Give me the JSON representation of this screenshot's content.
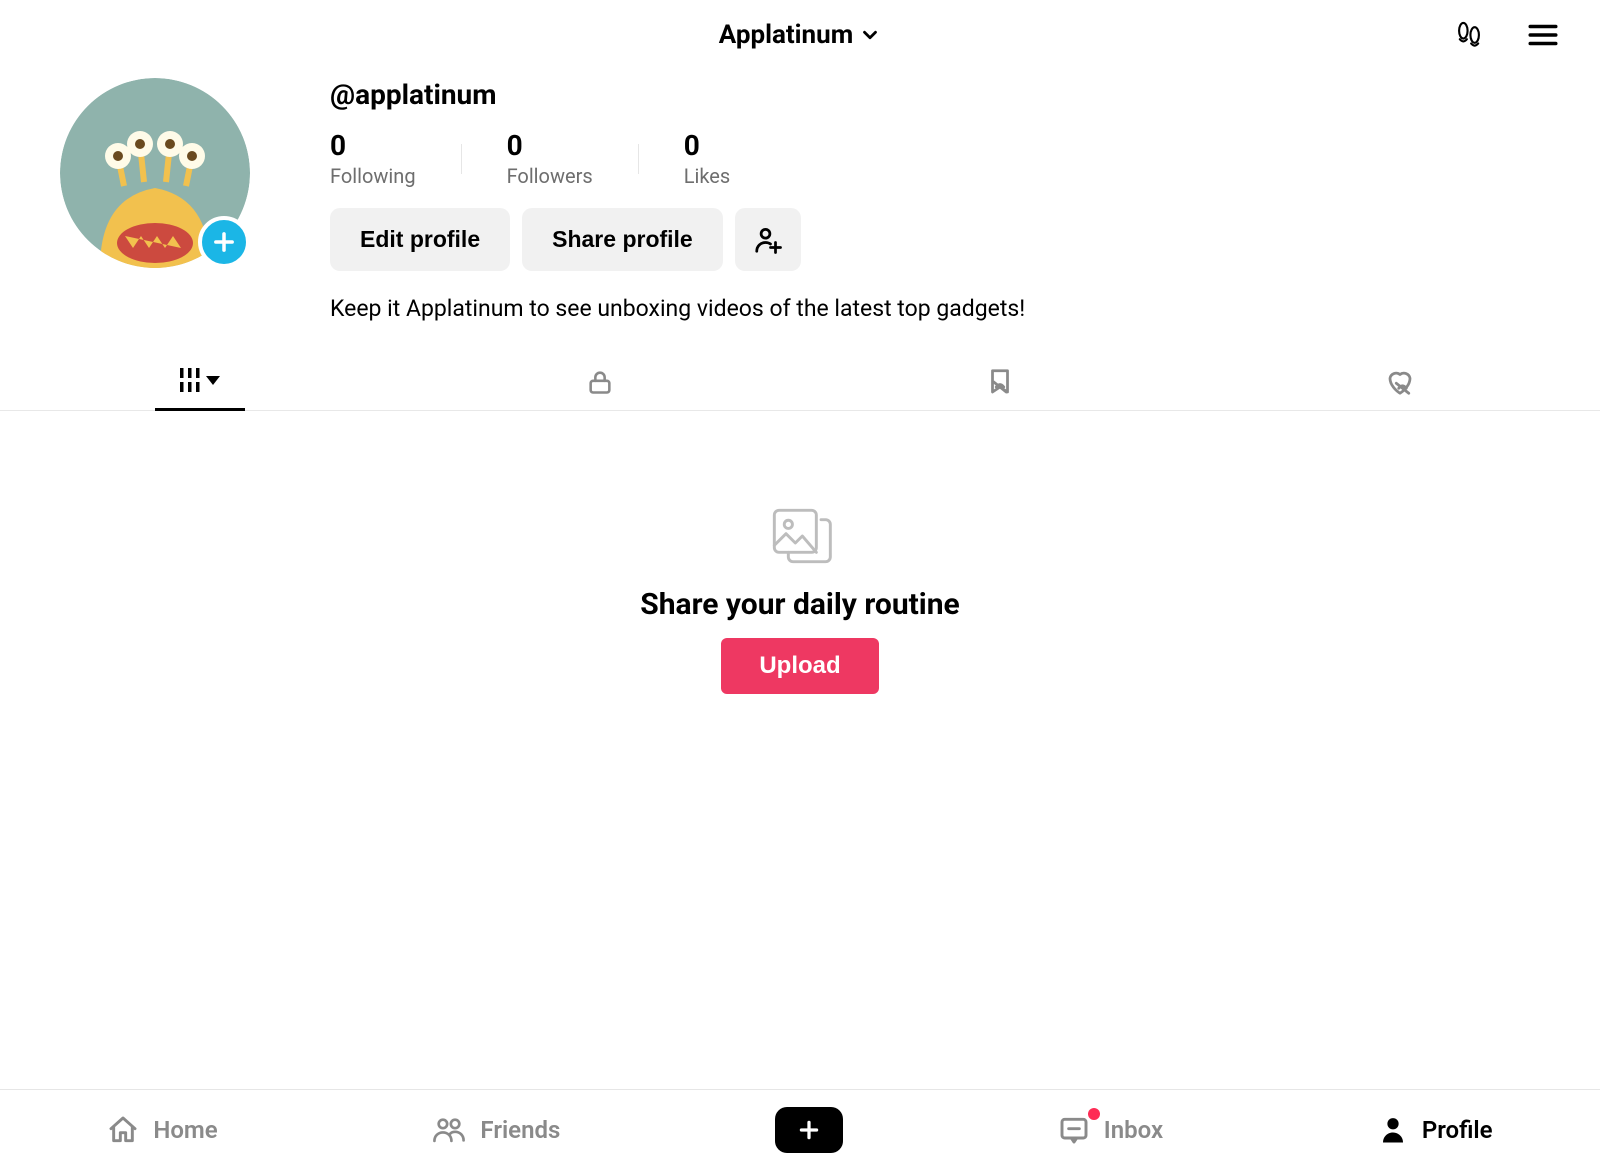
{
  "header": {
    "display_name": "Applatinum"
  },
  "profile": {
    "handle": "@applatinum",
    "bio": "Keep it Applatinum to see unboxing videos of the latest top gadgets!"
  },
  "stats": {
    "following_value": "0",
    "following_label": "Following",
    "followers_value": "0",
    "followers_label": "Followers",
    "likes_value": "0",
    "likes_label": "Likes"
  },
  "actions": {
    "edit_profile": "Edit profile",
    "share_profile": "Share profile"
  },
  "empty": {
    "title": "Share your daily routine",
    "upload": "Upload"
  },
  "nav": {
    "home": "Home",
    "friends": "Friends",
    "inbox": "Inbox",
    "profile": "Profile",
    "inbox_has_notification": true,
    "active": "profile"
  }
}
